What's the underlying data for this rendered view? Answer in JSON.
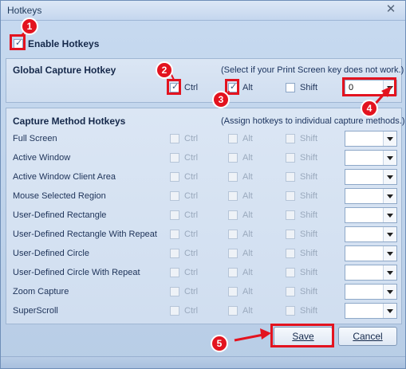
{
  "window": {
    "title": "Hotkeys"
  },
  "enable": {
    "label": "Enable Hotkeys",
    "checked": true
  },
  "global": {
    "heading": "Global Capture Hotkey",
    "note": "(Select if your Print Screen key does not work.)",
    "ctrl": "Ctrl",
    "alt": "Alt",
    "shift": "Shift",
    "key_value": "0"
  },
  "methods": {
    "heading": "Capture Method Hotkeys",
    "note": "(Assign hotkeys to individual capture methods.)",
    "modifier_labels": {
      "ctrl": "Ctrl",
      "alt": "Alt",
      "shift": "Shift"
    },
    "rows": [
      "Full Screen",
      "Active Window",
      "Active Window Client Area",
      "Mouse Selected Region",
      "User-Defined Rectangle",
      "User-Defined Rectangle With Repeat",
      "User-Defined Circle",
      "User-Defined Circle With Repeat",
      "Zoom Capture",
      "SuperScroll"
    ]
  },
  "buttons": {
    "save": "Save",
    "cancel": "Cancel"
  },
  "annotations": {
    "b1": "1",
    "b2": "2",
    "b3": "3",
    "b4": "4",
    "b5": "5"
  },
  "colors": {
    "highlight": "#e3131f"
  }
}
